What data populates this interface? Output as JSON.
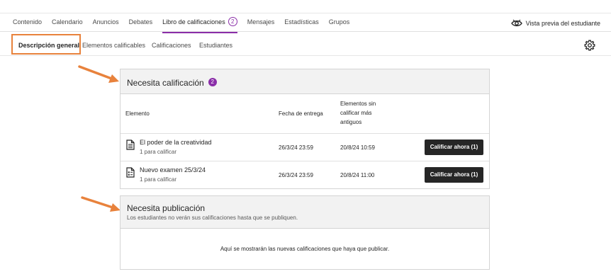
{
  "topnav": {
    "tabs": [
      {
        "label": "Contenido"
      },
      {
        "label": "Calendario"
      },
      {
        "label": "Anuncios"
      },
      {
        "label": "Debates"
      },
      {
        "label": "Libro de calificaciones",
        "badge": "2"
      },
      {
        "label": "Mensajes"
      },
      {
        "label": "Estadísticas"
      },
      {
        "label": "Grupos"
      }
    ],
    "active_tab": "Libro de calificaciones",
    "student_preview_label": "Vista previa del estudiante"
  },
  "subnav": {
    "items": [
      {
        "label": "Descripción general"
      },
      {
        "label": "Elementos calificables"
      },
      {
        "label": "Calificaciones"
      },
      {
        "label": "Estudiantes"
      }
    ],
    "active_item": "Descripción general"
  },
  "needs_grading": {
    "title": "Necesita calificación",
    "count": "2",
    "columns": {
      "item": "Elemento",
      "due_date": "Fecha de entrega",
      "oldest_ungraded_1": "Elementos sin",
      "oldest_ungraded_2": "calificar más",
      "oldest_ungraded_3": "antiguos"
    },
    "rows": [
      {
        "icon": "document-icon",
        "name": "El poder de la creatividad",
        "sub": "1 para calificar",
        "due": "26/3/24 23:59",
        "oldest": "20/8/24 10:59",
        "button": "Calificar ahora (1)"
      },
      {
        "icon": "test-icon",
        "name": "Nuevo examen 25/3/24",
        "sub": "1 para calificar",
        "due": "26/3/24 23:59",
        "oldest": "20/8/24 11:00",
        "button": "Calificar ahora (1)"
      }
    ]
  },
  "needs_posting": {
    "title": "Necesita publicación",
    "subtitle": "Los estudiantes no verán sus calificaciones hasta que se publiquen.",
    "empty_message": "Aquí se mostrarán las nuevas calificaciones que haya que publicar."
  },
  "colors": {
    "accent": "#8a2ea8",
    "highlight": "#e8823c",
    "button": "#262626"
  }
}
